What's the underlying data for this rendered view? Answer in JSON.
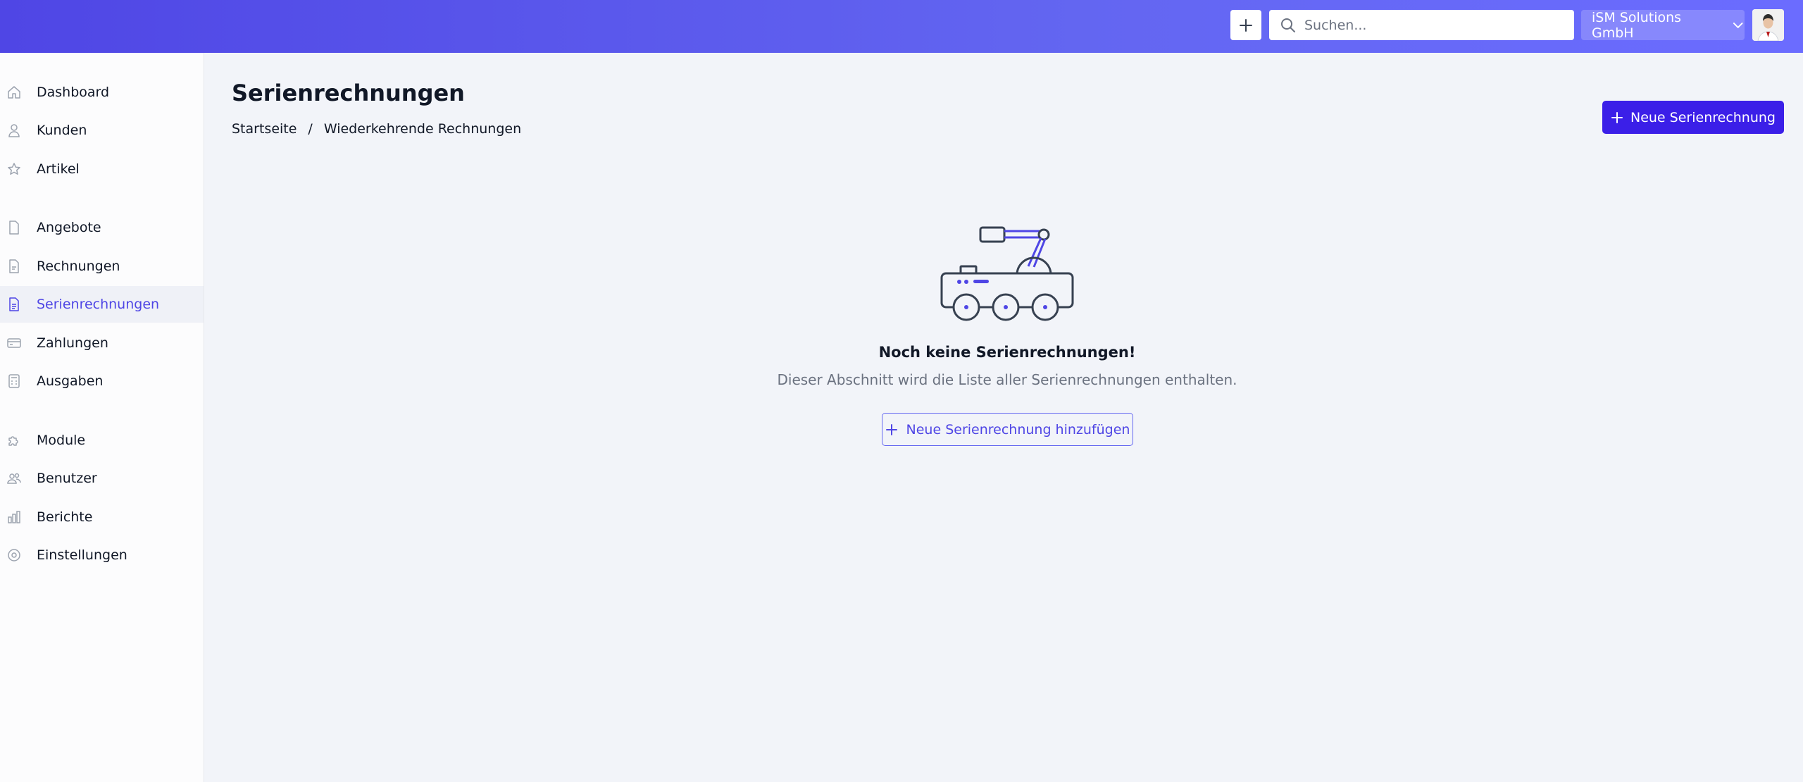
{
  "topbar": {
    "search_placeholder": "Suchen...",
    "company": "iSM Solutions GmbH",
    "brand_color": "#5b5bf7"
  },
  "sidebar": {
    "items": [
      {
        "label": "Dashboard",
        "icon": "home-icon"
      },
      {
        "label": "Kunden",
        "icon": "user-icon"
      },
      {
        "label": "Artikel",
        "icon": "star-icon"
      },
      {
        "label": "Angebote",
        "icon": "document-icon"
      },
      {
        "label": "Rechnungen",
        "icon": "invoice-icon"
      },
      {
        "label": "Serienrechnungen",
        "icon": "recurring-invoice-icon",
        "active": true
      },
      {
        "label": "Zahlungen",
        "icon": "credit-card-icon"
      },
      {
        "label": "Ausgaben",
        "icon": "calculator-icon"
      },
      {
        "label": "Module",
        "icon": "puzzle-icon"
      },
      {
        "label": "Benutzer",
        "icon": "users-icon"
      },
      {
        "label": "Berichte",
        "icon": "chart-bar-icon"
      },
      {
        "label": "Einstellungen",
        "icon": "cog-icon"
      }
    ]
  },
  "main": {
    "title": "Serienrechnungen",
    "breadcrumb": [
      "Startseite",
      "Wiederkehrende Rechnungen"
    ],
    "breadcrumb_separator": "/",
    "new_button": "Neue Serienrechnung",
    "empty": {
      "title": "Noch keine Serienrechnungen!",
      "description": "Dieser Abschnitt wird die Liste aller Serienrechnungen enthalten.",
      "add_button": "Neue Serienrechnung hinzufügen"
    },
    "accent_color": "#3b1fe8"
  }
}
